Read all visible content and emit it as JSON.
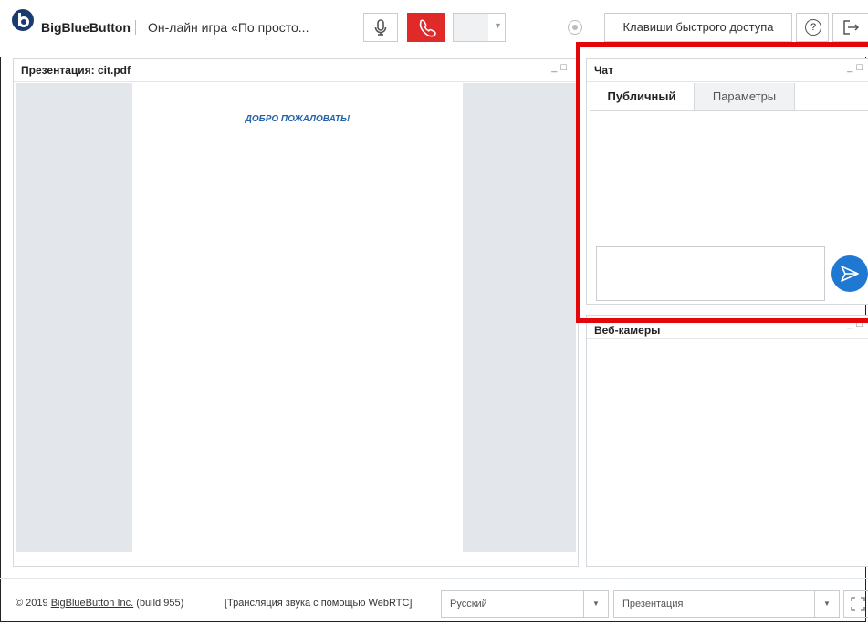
{
  "toolbar": {
    "brand": "BigBlueButton",
    "meeting_title": "Он-лайн игра «По просто...",
    "shortcuts_label": "Клавиши быстрого доступа",
    "help_label": "?"
  },
  "presentation": {
    "title": "Презентация: cit.pdf",
    "slide_text": "ДОБРО ПОЖАЛОВАТЬ!"
  },
  "chat": {
    "title": "Чат",
    "tabs": [
      {
        "label": "Публичный",
        "active": true
      },
      {
        "label": "Параметры",
        "active": false
      }
    ],
    "message_value": ""
  },
  "webcams": {
    "title": "Веб-камеры"
  },
  "footer": {
    "copyright_prefix": "© 2019 ",
    "copyright_link": "BigBlueButton Inc.",
    "build": " (build 955)",
    "audio_note": "[Трансляция звука с помощью WebRTC]",
    "language": "Русский",
    "layout": "Презентация"
  },
  "colors": {
    "hangup": "#e02a2a",
    "send": "#1f78d1",
    "highlight": "#e4070a",
    "slide_text": "#2463a8"
  }
}
